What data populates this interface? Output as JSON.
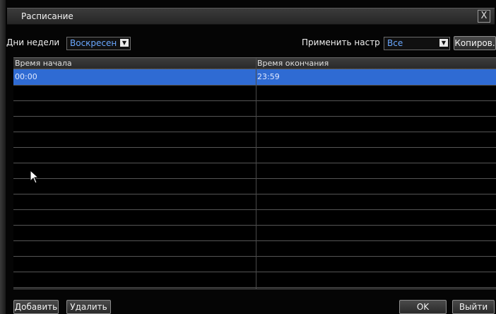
{
  "window": {
    "title": "Расписание",
    "close_symbol": "X"
  },
  "filters": {
    "weekday_label": "Дни недели",
    "weekday_value": "Воскресен",
    "apply_label": "Применить настр",
    "apply_value": "Все",
    "copy_button": "Копиров."
  },
  "table": {
    "headers": [
      "Время начала",
      "Время окончания"
    ],
    "rows": [
      {
        "start": "00:00",
        "end": "23:59",
        "selected": true
      }
    ],
    "empty_row_count": 13
  },
  "footer": {
    "add_button": "Добавить",
    "delete_button": "Удалить",
    "ok_button": "OK",
    "exit_button": "Выйти"
  },
  "colors": {
    "selection": "#2f6bd3",
    "dropdown_text": "#6aa8ff"
  }
}
